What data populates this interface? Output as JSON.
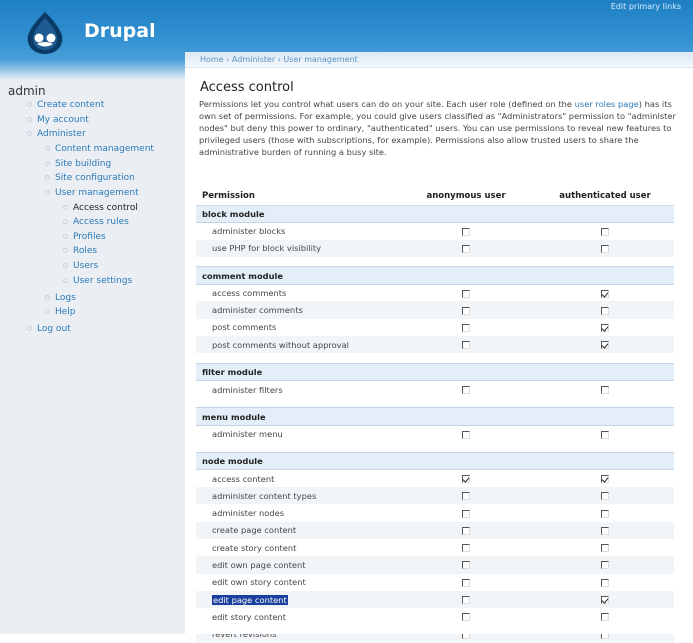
{
  "header": {
    "site_name": "Drupal",
    "primary_links": "Edit primary links",
    "colors": {
      "header": "#2f8fd0",
      "link": "#2a7ab8"
    }
  },
  "sidebar": {
    "title": "admin",
    "items": [
      {
        "label": "Create content",
        "indent": 0
      },
      {
        "label": "My account",
        "indent": 0
      },
      {
        "label": "Administer",
        "indent": 0
      },
      {
        "label": "Content management",
        "indent": 1
      },
      {
        "label": "Site building",
        "indent": 1
      },
      {
        "label": "Site configuration",
        "indent": 1
      },
      {
        "label": "User management",
        "indent": 1
      },
      {
        "label": "Access control",
        "indent": 2,
        "active": true
      },
      {
        "label": "Access rules",
        "indent": 2
      },
      {
        "label": "Profiles",
        "indent": 2
      },
      {
        "label": "Roles",
        "indent": 2
      },
      {
        "label": "Users",
        "indent": 2
      },
      {
        "label": "User settings",
        "indent": 2
      },
      {
        "label": "Logs",
        "indent": 1
      },
      {
        "label": "Help",
        "indent": 1
      },
      {
        "label": "Log out",
        "indent": 0
      }
    ]
  },
  "breadcrumb": "Home › Administer › User management",
  "page_title": "Access control",
  "intro": {
    "before_link": "Permissions let you control what users can do on your site. Each user role (defined on the ",
    "link": "user roles page",
    "after_link": ") has its own set of permissions. For example, you could give users classified as \"Administrators\" permission to \"administer nodes\" but deny this power to ordinary, \"authenticated\" users. You can use permissions to reveal new features to privileged users (those with subscriptions, for example). Permissions also allow trusted users to share the administrative burden of running a busy site."
  },
  "table": {
    "headers": {
      "permission": "Permission",
      "anonymous": "anonymous user",
      "authenticated": "authenticated user"
    },
    "modules": [
      {
        "name": "block module",
        "perms": [
          {
            "label": "administer blocks",
            "anon": false,
            "auth": false
          },
          {
            "label": "use PHP for block visibility",
            "anon": false,
            "auth": false
          }
        ]
      },
      {
        "name": "comment module",
        "perms": [
          {
            "label": "access comments",
            "anon": false,
            "auth": true
          },
          {
            "label": "administer comments",
            "anon": false,
            "auth": false
          },
          {
            "label": "post comments",
            "anon": false,
            "auth": true
          },
          {
            "label": "post comments without approval",
            "anon": false,
            "auth": true
          }
        ]
      },
      {
        "name": "filter module",
        "perms": [
          {
            "label": "administer filters",
            "anon": false,
            "auth": false
          }
        ]
      },
      {
        "name": "menu module",
        "perms": [
          {
            "label": "administer menu",
            "anon": false,
            "auth": false
          }
        ]
      },
      {
        "name": "node module",
        "perms": [
          {
            "label": "access content",
            "anon": true,
            "auth": true
          },
          {
            "label": "administer content types",
            "anon": false,
            "auth": false
          },
          {
            "label": "administer nodes",
            "anon": false,
            "auth": false
          },
          {
            "label": "create page content",
            "anon": false,
            "auth": false
          },
          {
            "label": "create story content",
            "anon": false,
            "auth": false
          },
          {
            "label": "edit own page content",
            "anon": false,
            "auth": false
          },
          {
            "label": "edit own story content",
            "anon": false,
            "auth": false
          },
          {
            "label": "edit page content",
            "anon": false,
            "auth": true,
            "highlighted": true
          },
          {
            "label": "edit story content",
            "anon": false,
            "auth": false
          },
          {
            "label": "revert revisions",
            "anon": false,
            "auth": false
          }
        ]
      }
    ]
  }
}
